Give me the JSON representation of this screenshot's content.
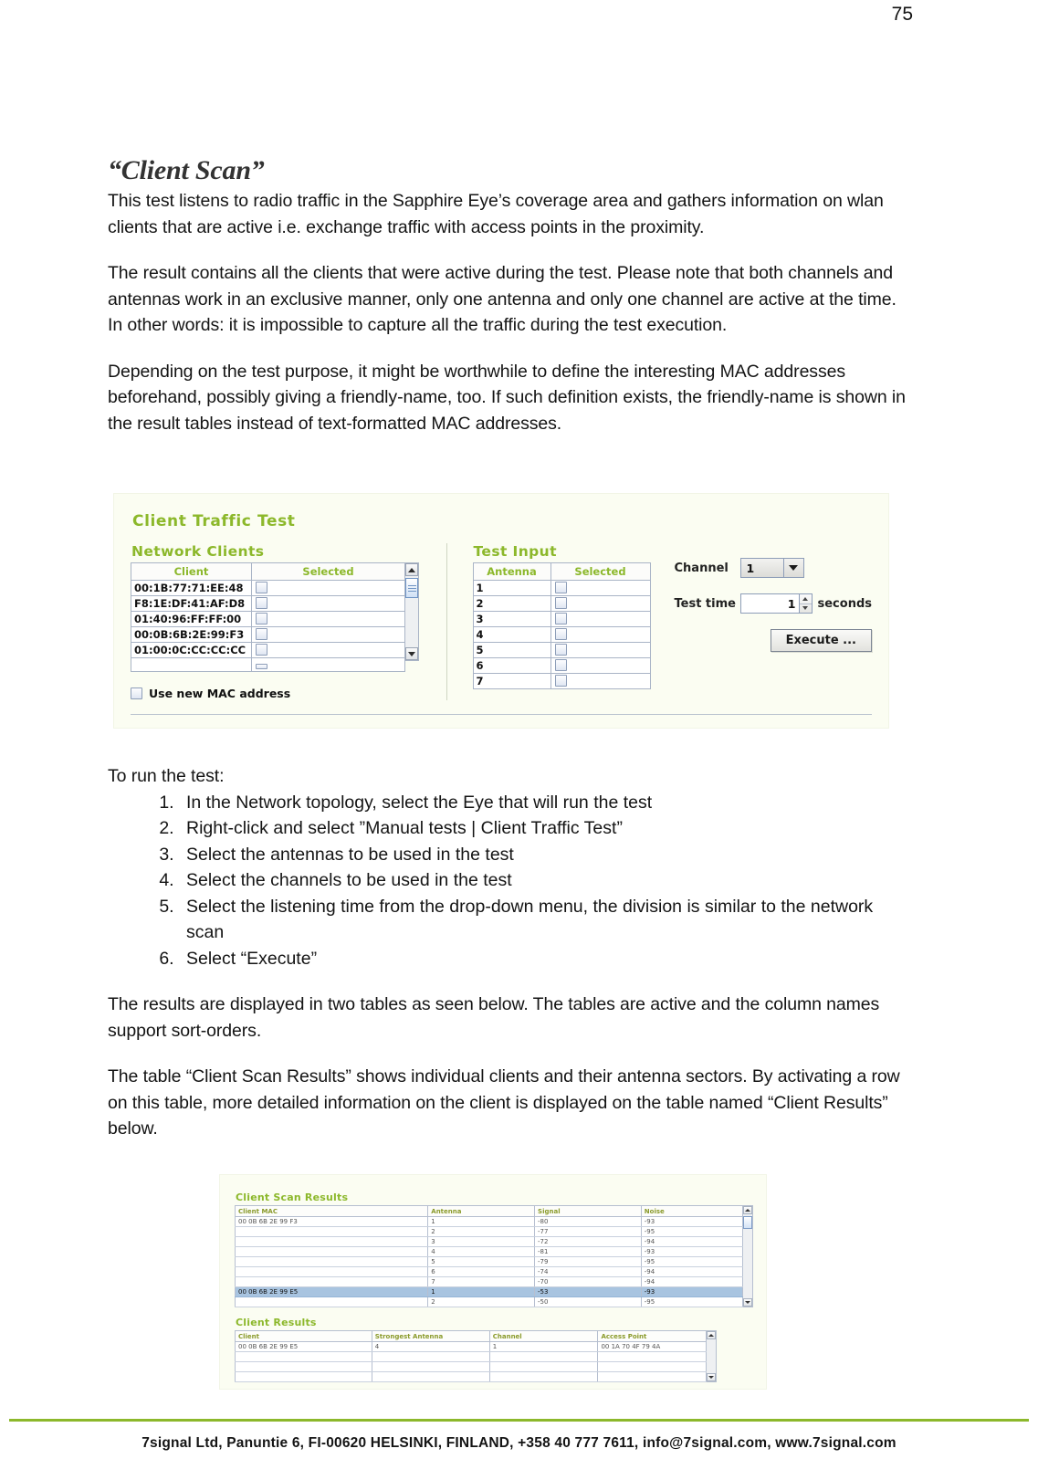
{
  "page": {
    "number": "75",
    "footer": "7signal Ltd, Panuntie 6, FI-00620 HELSINKI, FINLAND, +358 40 777 7611, info@7signal.com, www.7signal.com",
    "accent_green": "#8cb82b"
  },
  "doc": {
    "title": "“Client Scan”",
    "para1": "This test listens to radio traffic in the Sapphire Eye’s coverage area and gathers information on wlan clients that are active i.e. exchange traffic with access points in the proximity.",
    "para2": "The result contains all the clients that were active during the test. Please note that both channels and antennas work in an exclusive manner, only one antenna and only one channel are active at the time. In other words: it is impossible to capture all the traffic during the test execution.",
    "para3": "Depending on the test purpose, it might be worthwhile to define the interesting MAC addresses beforehand, possibly giving a friendly-name, too. If such definition exists, the friendly-name is shown in the result tables instead of text-formatted MAC addresses.",
    "run_intro": "To run the test:",
    "steps": [
      "In the Network topology, select the Eye that will run the test",
      "Right-click and select ”Manual tests | Client Traffic Test”",
      "Select the antennas to be used in the test",
      "Select the channels to be used in the test",
      "Select the listening time from the drop-down menu, the division is similar to the network scan",
      "Select “Execute”"
    ],
    "para4": "The results are displayed in two tables as seen below. The tables are active and the column names support sort-orders.",
    "para5": "The table “Client Scan Results” shows individual clients and their antenna sectors. By activating a row on this table, more detailed information on the client is displayed on the table named “Client Results” below."
  },
  "client_traffic_test": {
    "title": "Client Traffic Test",
    "network_clients": {
      "heading": "Network Clients",
      "columns": [
        "Client",
        "Selected"
      ],
      "rows": [
        "00:1B:77:71:EE:48",
        "F8:1E:DF:41:AF:D8",
        "01:40:96:FF:FF:00",
        "00:0B:6B:2E:99:F3",
        "01:00:0C:CC:CC:CC"
      ],
      "use_new_mac_label": "Use new MAC address",
      "use_new_mac_checked": false
    },
    "test_input": {
      "heading": "Test Input",
      "columns": [
        "Antenna",
        "Selected"
      ],
      "rows": [
        "1",
        "2",
        "3",
        "4",
        "5",
        "6",
        "7"
      ]
    },
    "controls": {
      "channel_label": "Channel",
      "channel_value": "1",
      "test_time_label": "Test time",
      "test_time_value": "1",
      "seconds_label": "seconds",
      "execute_label": "Execute ..."
    }
  },
  "results_shot": {
    "scan": {
      "title": "Client Scan Results",
      "columns": [
        "Client MAC",
        "Antenna",
        "Signal",
        "Noise"
      ],
      "rows": [
        {
          "mac": "00 0B 6B 2E 99 F3",
          "antenna": "1",
          "signal": "-80",
          "noise": "-93",
          "selected": false
        },
        {
          "mac": "",
          "antenna": "2",
          "signal": "-77",
          "noise": "-95",
          "selected": false
        },
        {
          "mac": "",
          "antenna": "3",
          "signal": "-72",
          "noise": "-94",
          "selected": false
        },
        {
          "mac": "",
          "antenna": "4",
          "signal": "-81",
          "noise": "-93",
          "selected": false
        },
        {
          "mac": "",
          "antenna": "5",
          "signal": "-79",
          "noise": "-95",
          "selected": false
        },
        {
          "mac": "",
          "antenna": "6",
          "signal": "-74",
          "noise": "-94",
          "selected": false
        },
        {
          "mac": "",
          "antenna": "7",
          "signal": "-70",
          "noise": "-94",
          "selected": false
        },
        {
          "mac": "00 0B 6B 2E 99 E5",
          "antenna": "1",
          "signal": "-53",
          "noise": "-93",
          "selected": true
        },
        {
          "mac": "",
          "antenna": "2",
          "signal": "-50",
          "noise": "-95",
          "selected": false
        }
      ]
    },
    "client": {
      "title": "Client Results",
      "columns": [
        "Client",
        "Strongest Antenna",
        "Channel",
        "Access Point"
      ],
      "rows": [
        {
          "client": "00 0B 6B 2E 99 E5",
          "strongest_antenna": "4",
          "channel": "1",
          "access_point": "00 1A 70 4F 79 4A"
        }
      ]
    }
  }
}
